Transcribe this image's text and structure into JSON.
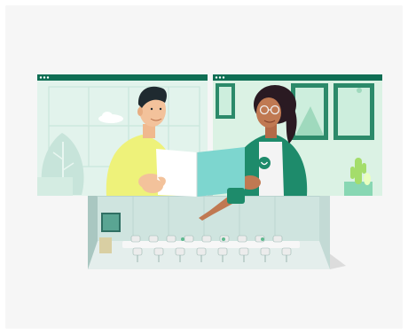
{
  "illustration": {
    "subject": "video-call-with-conference-room",
    "icons": [
      "browser-window-icon",
      "heart-badge-icon",
      "plant-icon",
      "cactus-icon"
    ]
  },
  "colors": {
    "background": "#f6f6f6",
    "window_bar": "#0f6e54",
    "window_left_bg": "#dff2ea",
    "window_right_bg": "#d8f0e2",
    "accent_green": "#1e8b6b",
    "document_teal": "#7dd6cf",
    "shirt_yellow": "#eef27a",
    "room_wall": "#cfe2de",
    "room_floor": "#e9f1ef"
  }
}
